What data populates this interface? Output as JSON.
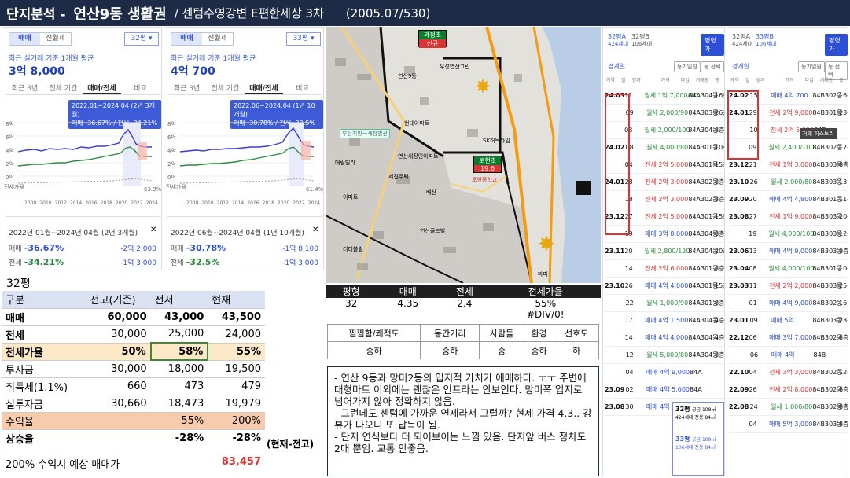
{
  "title": {
    "t1": "단지분석 -",
    "t2": "연산9동 생활권",
    "t3": "/ 센텀수영강변 E편한세상 3차",
    "t4": "(2005.07/530)"
  },
  "panel1": {
    "seg": [
      "매매",
      "전월세"
    ],
    "pyeong": "32평 ▾",
    "sub": "최근 실거래 기준 1개월 평균",
    "price": "3억 8,000",
    "tabs": [
      "최근 3년",
      "전체 기간",
      "매매/전세",
      "비교"
    ],
    "tooltip1": "2022.01~2024.04 (2년 3개월)",
    "tooltip2": "매매 -36.67% / 전세 -34.21%",
    "y": [
      "8억",
      "6억",
      "4억",
      "2억",
      "0억"
    ],
    "x": [
      "2008",
      "2010",
      "2012",
      "2014",
      "2016",
      "2018",
      "2020",
      "2022",
      "2024"
    ],
    "ylabel": "전세가율",
    "yright": [
      "80%",
      "63.9%"
    ],
    "period": "2022년 01월~2024년 04월 (2년 3개월)",
    "close": "✕",
    "r1l": "매매",
    "r1v": "-36.67%",
    "r1r": "-2억 2,000",
    "r2l": "전세",
    "r2v": "-34.21%",
    "r2r": "-1억 3,000"
  },
  "panel2": {
    "seg": [
      "매매",
      "전월세"
    ],
    "pyeong": "33평 ▾",
    "sub": "최근 실거래 기준 1개월 평균",
    "price": "4억 700",
    "tabs": [
      "최근 3년",
      "전체 기간",
      "매매/전세",
      "비교"
    ],
    "tooltip1": "2022.06~2024.04 (1년 10개월)",
    "tooltip2": "매매 -30.78% / 전세 -32.5%",
    "y": [
      "8억",
      "6억",
      "4억",
      "2억",
      "0억"
    ],
    "x": [
      "2008",
      "2010",
      "2012",
      "2014",
      "2016",
      "2018",
      "2020",
      "2022",
      "2024"
    ],
    "ylabel": "전세가율",
    "yright": [
      "80%",
      "61.4%"
    ],
    "period": "2022년 06월~2024년 04월 (1년 10개월)",
    "close": "✕",
    "r1l": "매매",
    "r1v": "-30.78%",
    "r1r": "-1억 8,100",
    "r2l": "전세",
    "r2v": "-32.5%",
    "r2r": "-1억 3,000"
  },
  "map": {
    "school1": "과정초",
    "school1b": "신규",
    "school2": "토현초",
    "school2b": "19.6",
    "labels": [
      "화성인데사",
      "연산9동",
      "우성연산그린",
      "우성연산1",
      "부산지방국세청",
      "대림빌라",
      "현대아파트",
      "연산새장인아파트",
      "라이온연산",
      "영남",
      "부산센텀",
      "SK허브라임",
      "세진주택",
      "거유빌리",
      "토현중학교",
      "배산",
      "유림빌리",
      "대동고",
      "이마트",
      "화성",
      "세진빌라",
      "연산골드빌",
      "가는골",
      "사직",
      "상인빌라",
      "마미",
      "오룡빌라",
      "리더블빌",
      "정원아파트",
      "해양빌라",
      "경미산"
    ],
    "tag": "부산지방국세청별관"
  },
  "summary": {
    "headers": [
      "평형",
      "매매",
      "전세",
      "전세가율"
    ],
    "values": [
      "32",
      "4.35",
      "2.4",
      "55%"
    ],
    "div": "#DIV/0!"
  },
  "eval": {
    "headers": [
      "찜찜함/쾌적도",
      "동간거리",
      "사람들",
      "환경",
      "선호도"
    ],
    "values": [
      "중하",
      "중하",
      "중",
      "중하",
      "하"
    ]
  },
  "notes": [
    "- 연산 9동과 망미2동의 입지적 가치가 애매하다. ㅜㅜ 주변에 대형마트 이외에는 괜찮은 인프라는 안보인다. 망미쪽 입지로 넘어가지 않아 정확하지 않음.",
    "- 그런데도 센텀에 가까운 연제라서 그럴까? 현제 가격 4.3.. 강뷰가 나오니 또 납득이 됨.",
    "- 단지 연식보다 더 되어보이는 느낌 있음. 단지앞 버스 정차도 2대 뿐임. 교통 안좋음."
  ],
  "table32": {
    "title": "32평",
    "header": [
      "구분",
      "전고(기준)",
      "전저",
      "현재"
    ],
    "rows": [
      [
        "매매",
        "60,000",
        "43,000",
        "43,500"
      ],
      [
        "전세",
        "30,000",
        "25,000",
        "24,000"
      ],
      [
        "전세가율",
        "50%",
        "58%",
        "55%"
      ],
      [
        "투자금",
        "30,000",
        "18,000",
        "19,500"
      ],
      [
        "취득세(1.1%)",
        "660",
        "473",
        "479"
      ],
      [
        "실투자금",
        "30,660",
        "18,473",
        "19,979"
      ],
      [
        "수익율",
        "",
        "-55%",
        "200%"
      ],
      [
        "상승율",
        "",
        "-28%",
        "-28%"
      ]
    ],
    "note": "(현재-전고)",
    "predict_label": "200% 수익시 예상 매매가",
    "predict_value": "83,457"
  },
  "tx1": {
    "h1": "32평A",
    "h2": "32평B",
    "sub": "424세대",
    "sub2": "106세대",
    "btn": "평형가",
    "lbl": "경계일",
    "btn2": "등기일원",
    "btn3": "등 선택",
    "cols": [
      "계약",
      "일",
      "경과",
      "가격",
      "타입",
      "거래동",
      "층"
    ],
    "rows": [
      [
        "24.03",
        "11",
        "",
        "월세 1억 7,000/40",
        "84A",
        "304동",
        "16층",
        "g"
      ],
      [
        "",
        "09",
        "",
        "월세 2,000/90",
        "84A",
        "303동",
        "26층",
        "g"
      ],
      [
        "",
        "08",
        "",
        "월세 2,000/100",
        "84A",
        "304동",
        "8층",
        "g"
      ],
      [
        "24.02",
        "08",
        "",
        "월세 4,000/80",
        "84A",
        "301동",
        "10층",
        "g"
      ],
      [
        "",
        "04",
        "",
        "전세 2억 5,000",
        "84A",
        "301동",
        "15층",
        "r"
      ],
      [
        "24.01",
        "28",
        "",
        "전세 2억 3,000",
        "84A",
        "302동",
        "8층",
        "r"
      ],
      [
        "",
        "18",
        "",
        "전세 2억 3,000",
        "84A",
        "302동",
        "3층",
        "r"
      ],
      [
        "23.12",
        "27",
        "",
        "전세 2억 5,000",
        "84A",
        "301동",
        "15층",
        "r"
      ],
      [
        "",
        "19",
        "",
        "매매 3억 8,000",
        "84A",
        "304동",
        "8층",
        "b"
      ],
      [
        "23.11",
        "20",
        "",
        "월세 2,800/120",
        "84A",
        "304동",
        "20층",
        "g"
      ],
      [
        "",
        "14",
        "",
        "전세 2억 6,000",
        "84A",
        "301동",
        "8층",
        "r"
      ],
      [
        "23.10",
        "26",
        "",
        "매매 4억 4,000",
        "84A",
        "301동",
        "15층",
        "b"
      ],
      [
        "",
        "22",
        "",
        "월세 1,000/90",
        "84A",
        "301동",
        "8층",
        "g"
      ],
      [
        "",
        "17",
        "",
        "매매 4억 1,500",
        "84A",
        "304동",
        "4층",
        "b"
      ],
      [
        "",
        "14",
        "",
        "매매 4억 4,000",
        "84A",
        "304동",
        "4층",
        "b"
      ],
      [
        "",
        "12",
        "",
        "월세 5,000/80",
        "84A",
        "304동",
        "8층",
        "g"
      ],
      [
        "",
        "04",
        "",
        "매매 4억 9,000",
        "84A",
        "",
        "",
        "b"
      ],
      [
        "23.09",
        "02",
        "",
        "매매 4억 5,000",
        "84A",
        "",
        "",
        "b"
      ],
      [
        "23.08",
        "30",
        "",
        "매매 4억 5,000",
        "84A",
        "",
        "",
        "b"
      ]
    ],
    "callout1": "32평",
    "callout1a": "공급 108㎡",
    "callout1b": "424세대",
    "callout1c": "전용 84㎡",
    "callout2": "33평",
    "callout2a": "공급 109㎡",
    "callout2b": "106세대",
    "callout2c": "전용 84㎡",
    "flag": "직거래"
  },
  "tx2": {
    "h1": "32평A",
    "h2": "33평B",
    "sub": "424세대",
    "sub2": "106세대",
    "btn": "평형가",
    "lbl": "경계일",
    "btn2": "등기일원",
    "btn3": "등 선택",
    "cols": [
      "계약",
      "일",
      "경과",
      "가격",
      "타입",
      "거래동",
      "층"
    ],
    "tooltip": "거래 히스토리",
    "rows": [
      [
        "24.02",
        "15",
        "",
        "매매 4억 700",
        "84B",
        "302동",
        "16층",
        "b"
      ],
      [
        "24.01",
        "29",
        "",
        "전세 2억 9,000",
        "84B",
        "301동",
        "23층",
        "r"
      ],
      [
        "",
        "10",
        "",
        "전세 2억 5,000",
        "84B",
        "",
        "",
        "r"
      ],
      [
        "",
        "09",
        "",
        "월세 2,400/100",
        "84B",
        "302동",
        "17층",
        "g"
      ],
      [
        "23.12",
        "21",
        "",
        "전세 1억 3,000",
        "84B",
        "303동",
        "8층",
        "r"
      ],
      [
        "23.10",
        "26",
        "",
        "월세 2,000/80",
        "84B",
        "303동",
        "13층",
        "g"
      ],
      [
        "23.09",
        "20",
        "",
        "매매 4억 4,800",
        "84B",
        "301동",
        "11층",
        "b"
      ],
      [
        "23.08",
        "27",
        "",
        "전세 1억 9,000",
        "84B",
        "303동",
        "20층",
        "r"
      ],
      [
        "",
        "19",
        "",
        "월세 4,000/100",
        "84B",
        "303동",
        "12층",
        "g"
      ],
      [
        "23.06",
        "13",
        "",
        "매매 4억 9,000",
        "84B",
        "303동",
        "9층",
        "b"
      ],
      [
        "23.04",
        "08",
        "",
        "월세 4,000/100",
        "84B",
        "301동",
        "10층",
        "g"
      ],
      [
        "23.03",
        "11",
        "",
        "전세 2억 2,000",
        "84B",
        "303동",
        "25층",
        "r"
      ],
      [
        "",
        "01",
        "",
        "매매 4억 9,000",
        "84B",
        "302동",
        "16층",
        "b"
      ],
      [
        "23.01",
        "09",
        "",
        "매매 5억",
        "84B",
        "303동",
        "23층",
        "b"
      ],
      [
        "22.12",
        "06",
        "",
        "매매 3억 7,000",
        "84B",
        "302동",
        "8층",
        "b"
      ],
      [
        "",
        "06",
        "",
        "매매 4억",
        "84B",
        "",
        "",
        "b"
      ],
      [
        "22.10",
        "04",
        "",
        "전세 3억 3,000",
        "84B",
        "302동",
        "12층",
        "r"
      ],
      [
        "22.09",
        "26",
        "",
        "전세 2억 8,000",
        "84B",
        "302동",
        "8층",
        "r"
      ],
      [
        "22.08",
        "24",
        "",
        "월세 1,000/80",
        "84B",
        "302동",
        "8층",
        "g"
      ],
      [
        "",
        "04",
        "",
        "매매 5억 3,000",
        "84B",
        "303동",
        "8층",
        "b"
      ]
    ],
    "flag": "직거래"
  }
}
